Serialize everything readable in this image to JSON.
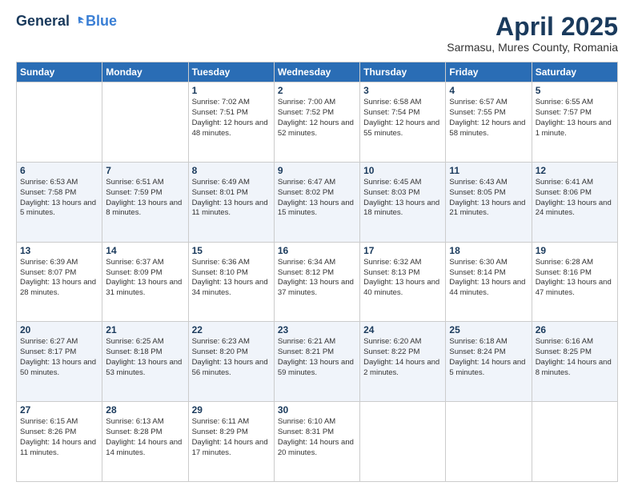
{
  "header": {
    "logo": {
      "general": "General",
      "blue": "Blue"
    },
    "title": "April 2025",
    "location": "Sarmasu, Mures County, Romania"
  },
  "days_of_week": [
    "Sunday",
    "Monday",
    "Tuesday",
    "Wednesday",
    "Thursday",
    "Friday",
    "Saturday"
  ],
  "weeks": [
    [
      {
        "day": "",
        "info": ""
      },
      {
        "day": "",
        "info": ""
      },
      {
        "day": "1",
        "info": "Sunrise: 7:02 AM\nSunset: 7:51 PM\nDaylight: 12 hours and 48 minutes."
      },
      {
        "day": "2",
        "info": "Sunrise: 7:00 AM\nSunset: 7:52 PM\nDaylight: 12 hours and 52 minutes."
      },
      {
        "day": "3",
        "info": "Sunrise: 6:58 AM\nSunset: 7:54 PM\nDaylight: 12 hours and 55 minutes."
      },
      {
        "day": "4",
        "info": "Sunrise: 6:57 AM\nSunset: 7:55 PM\nDaylight: 12 hours and 58 minutes."
      },
      {
        "day": "5",
        "info": "Sunrise: 6:55 AM\nSunset: 7:57 PM\nDaylight: 13 hours and 1 minute."
      }
    ],
    [
      {
        "day": "6",
        "info": "Sunrise: 6:53 AM\nSunset: 7:58 PM\nDaylight: 13 hours and 5 minutes."
      },
      {
        "day": "7",
        "info": "Sunrise: 6:51 AM\nSunset: 7:59 PM\nDaylight: 13 hours and 8 minutes."
      },
      {
        "day": "8",
        "info": "Sunrise: 6:49 AM\nSunset: 8:01 PM\nDaylight: 13 hours and 11 minutes."
      },
      {
        "day": "9",
        "info": "Sunrise: 6:47 AM\nSunset: 8:02 PM\nDaylight: 13 hours and 15 minutes."
      },
      {
        "day": "10",
        "info": "Sunrise: 6:45 AM\nSunset: 8:03 PM\nDaylight: 13 hours and 18 minutes."
      },
      {
        "day": "11",
        "info": "Sunrise: 6:43 AM\nSunset: 8:05 PM\nDaylight: 13 hours and 21 minutes."
      },
      {
        "day": "12",
        "info": "Sunrise: 6:41 AM\nSunset: 8:06 PM\nDaylight: 13 hours and 24 minutes."
      }
    ],
    [
      {
        "day": "13",
        "info": "Sunrise: 6:39 AM\nSunset: 8:07 PM\nDaylight: 13 hours and 28 minutes."
      },
      {
        "day": "14",
        "info": "Sunrise: 6:37 AM\nSunset: 8:09 PM\nDaylight: 13 hours and 31 minutes."
      },
      {
        "day": "15",
        "info": "Sunrise: 6:36 AM\nSunset: 8:10 PM\nDaylight: 13 hours and 34 minutes."
      },
      {
        "day": "16",
        "info": "Sunrise: 6:34 AM\nSunset: 8:12 PM\nDaylight: 13 hours and 37 minutes."
      },
      {
        "day": "17",
        "info": "Sunrise: 6:32 AM\nSunset: 8:13 PM\nDaylight: 13 hours and 40 minutes."
      },
      {
        "day": "18",
        "info": "Sunrise: 6:30 AM\nSunset: 8:14 PM\nDaylight: 13 hours and 44 minutes."
      },
      {
        "day": "19",
        "info": "Sunrise: 6:28 AM\nSunset: 8:16 PM\nDaylight: 13 hours and 47 minutes."
      }
    ],
    [
      {
        "day": "20",
        "info": "Sunrise: 6:27 AM\nSunset: 8:17 PM\nDaylight: 13 hours and 50 minutes."
      },
      {
        "day": "21",
        "info": "Sunrise: 6:25 AM\nSunset: 8:18 PM\nDaylight: 13 hours and 53 minutes."
      },
      {
        "day": "22",
        "info": "Sunrise: 6:23 AM\nSunset: 8:20 PM\nDaylight: 13 hours and 56 minutes."
      },
      {
        "day": "23",
        "info": "Sunrise: 6:21 AM\nSunset: 8:21 PM\nDaylight: 13 hours and 59 minutes."
      },
      {
        "day": "24",
        "info": "Sunrise: 6:20 AM\nSunset: 8:22 PM\nDaylight: 14 hours and 2 minutes."
      },
      {
        "day": "25",
        "info": "Sunrise: 6:18 AM\nSunset: 8:24 PM\nDaylight: 14 hours and 5 minutes."
      },
      {
        "day": "26",
        "info": "Sunrise: 6:16 AM\nSunset: 8:25 PM\nDaylight: 14 hours and 8 minutes."
      }
    ],
    [
      {
        "day": "27",
        "info": "Sunrise: 6:15 AM\nSunset: 8:26 PM\nDaylight: 14 hours and 11 minutes."
      },
      {
        "day": "28",
        "info": "Sunrise: 6:13 AM\nSunset: 8:28 PM\nDaylight: 14 hours and 14 minutes."
      },
      {
        "day": "29",
        "info": "Sunrise: 6:11 AM\nSunset: 8:29 PM\nDaylight: 14 hours and 17 minutes."
      },
      {
        "day": "30",
        "info": "Sunrise: 6:10 AM\nSunset: 8:31 PM\nDaylight: 14 hours and 20 minutes."
      },
      {
        "day": "",
        "info": ""
      },
      {
        "day": "",
        "info": ""
      },
      {
        "day": "",
        "info": ""
      }
    ]
  ]
}
